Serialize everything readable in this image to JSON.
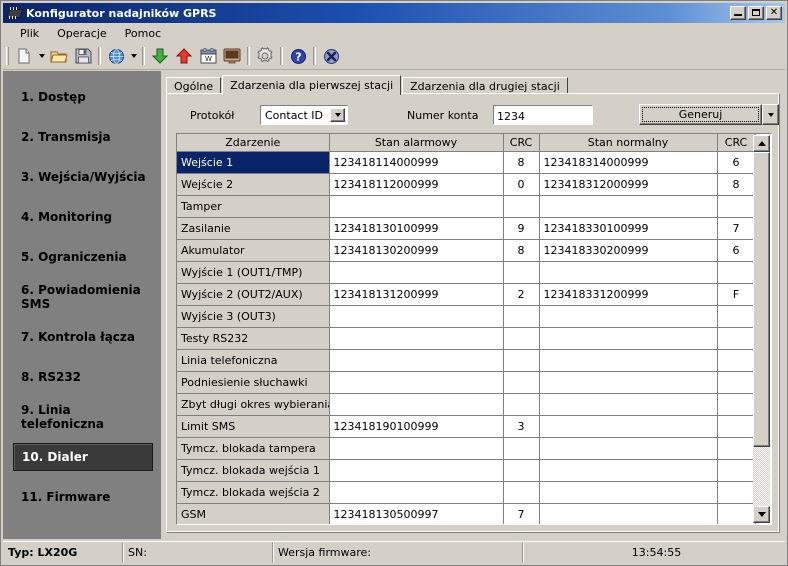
{
  "window": {
    "title": "Konfigurator nadajników GPRS",
    "icon": "chip-icon",
    "minimize_label": "_",
    "maximize_label": "□",
    "close_label": "✕"
  },
  "menubar": {
    "items": [
      {
        "label": "Plik"
      },
      {
        "label": "Operacje"
      },
      {
        "label": "Pomoc"
      }
    ]
  },
  "toolbar": {
    "items": [
      {
        "name": "new-file-icon",
        "type": "icon"
      },
      {
        "name": "new-file-dropdown-icon",
        "type": "dropdown"
      },
      {
        "name": "open-folder-icon",
        "type": "icon"
      },
      {
        "name": "save-disk-icon",
        "type": "icon"
      },
      {
        "name": "separator-1",
        "type": "sep"
      },
      {
        "name": "globe-icon",
        "type": "icon"
      },
      {
        "name": "globe-dropdown-icon",
        "type": "dropdown"
      },
      {
        "name": "separator-2",
        "type": "sep"
      },
      {
        "name": "download-green-arrow-icon",
        "type": "icon"
      },
      {
        "name": "upload-red-arrow-icon",
        "type": "icon"
      },
      {
        "name": "calendar-icon",
        "type": "icon"
      },
      {
        "name": "monitor-icon",
        "type": "icon"
      },
      {
        "name": "separator-3",
        "type": "sep"
      },
      {
        "name": "settings-gear-icon",
        "type": "icon"
      },
      {
        "name": "separator-4",
        "type": "sep"
      },
      {
        "name": "help-question-icon",
        "type": "icon"
      },
      {
        "name": "separator-5",
        "type": "sep"
      },
      {
        "name": "exit-icon",
        "type": "icon"
      }
    ]
  },
  "sidebar": {
    "items": [
      {
        "label": "1. Dostęp",
        "active": false
      },
      {
        "label": "2. Transmisja",
        "active": false
      },
      {
        "label": "3. Wejścia/Wyjścia",
        "active": false
      },
      {
        "label": "4. Monitoring",
        "active": false
      },
      {
        "label": "5. Ograniczenia",
        "active": false
      },
      {
        "label": "6. Powiadomienia SMS",
        "active": false
      },
      {
        "label": "7. Kontrola łącza",
        "active": false
      },
      {
        "label": "8. RS232",
        "active": false
      },
      {
        "label": "9. Linia telefoniczna",
        "active": false
      },
      {
        "label": "10. Dialer",
        "active": true
      },
      {
        "label": "11. Firmware",
        "active": false
      }
    ]
  },
  "tabs": [
    {
      "label": "Ogólne",
      "active": false
    },
    {
      "label": "Zdarzenia dla pierwszej stacji",
      "active": true
    },
    {
      "label": "Zdarzenia dla drugiej stacji",
      "active": false
    }
  ],
  "form": {
    "protocol_label": "Protokół",
    "protocol_value": "Contact ID",
    "account_label": "Numer konta",
    "account_value": "1234",
    "generate_button": "Generuj"
  },
  "grid": {
    "columns": [
      "Zdarzenie",
      "Stan alarmowy",
      "CRC",
      "Stan normalny",
      "CRC"
    ],
    "rows": [
      {
        "event": "Wejście 1",
        "alarm": "123418114000999",
        "crc1": "8",
        "normal": "123418314000999",
        "crc2": "6",
        "selected": true
      },
      {
        "event": "Wejście 2",
        "alarm": "123418112000999",
        "crc1": "0",
        "normal": "123418312000999",
        "crc2": "8",
        "selected": false
      },
      {
        "event": "Tamper",
        "alarm": "",
        "crc1": "",
        "normal": "",
        "crc2": "",
        "selected": false
      },
      {
        "event": "Zasilanie",
        "alarm": "123418130100999",
        "crc1": "9",
        "normal": "123418330100999",
        "crc2": "7",
        "selected": false
      },
      {
        "event": "Akumulator",
        "alarm": "123418130200999",
        "crc1": "8",
        "normal": "123418330200999",
        "crc2": "6",
        "selected": false
      },
      {
        "event": "Wyjście 1 (OUT1/TMP)",
        "alarm": "",
        "crc1": "",
        "normal": "",
        "crc2": "",
        "selected": false
      },
      {
        "event": "Wyjście 2 (OUT2/AUX)",
        "alarm": "123418131200999",
        "crc1": "2",
        "normal": "123418331200999",
        "crc2": "F",
        "selected": false
      },
      {
        "event": "Wyjście 3 (OUT3)",
        "alarm": "",
        "crc1": "",
        "normal": "",
        "crc2": "",
        "selected": false
      },
      {
        "event": "Testy RS232",
        "alarm": "",
        "crc1": "",
        "normal": "",
        "crc2": "",
        "selected": false
      },
      {
        "event": "Linia telefoniczna",
        "alarm": "",
        "crc1": "",
        "normal": "",
        "crc2": "",
        "selected": false
      },
      {
        "event": "Podniesienie słuchawki",
        "alarm": "",
        "crc1": "",
        "normal": "",
        "crc2": "",
        "selected": false
      },
      {
        "event": "Zbyt długi okres wybierania ...",
        "alarm": "",
        "crc1": "",
        "normal": "",
        "crc2": "",
        "selected": false
      },
      {
        "event": "Limit SMS",
        "alarm": "123418190100999",
        "crc1": "3",
        "normal": "",
        "crc2": "",
        "selected": false
      },
      {
        "event": "Tymcz. blokada tampera",
        "alarm": "",
        "crc1": "",
        "normal": "",
        "crc2": "",
        "selected": false
      },
      {
        "event": "Tymcz. blokada wejścia 1",
        "alarm": "",
        "crc1": "",
        "normal": "",
        "crc2": "",
        "selected": false
      },
      {
        "event": "Tymcz. blokada wejścia 2",
        "alarm": "",
        "crc1": "",
        "normal": "",
        "crc2": "",
        "selected": false
      },
      {
        "event": "GSM",
        "alarm": "123418130500997",
        "crc1": "7",
        "normal": "",
        "crc2": "",
        "selected": false
      }
    ]
  },
  "statusbar": {
    "type": "Typ: LX20G",
    "serial": "SN:",
    "firmware": "Wersja firmware:",
    "time": "13:54:55"
  },
  "colors": {
    "titlebar_start": "#0a246a",
    "titlebar_end": "#a6c8ef",
    "face": "#d4d0c8",
    "sidebar": "#808080",
    "selection": "#0a246a",
    "active_item": "#3a3a3a"
  }
}
